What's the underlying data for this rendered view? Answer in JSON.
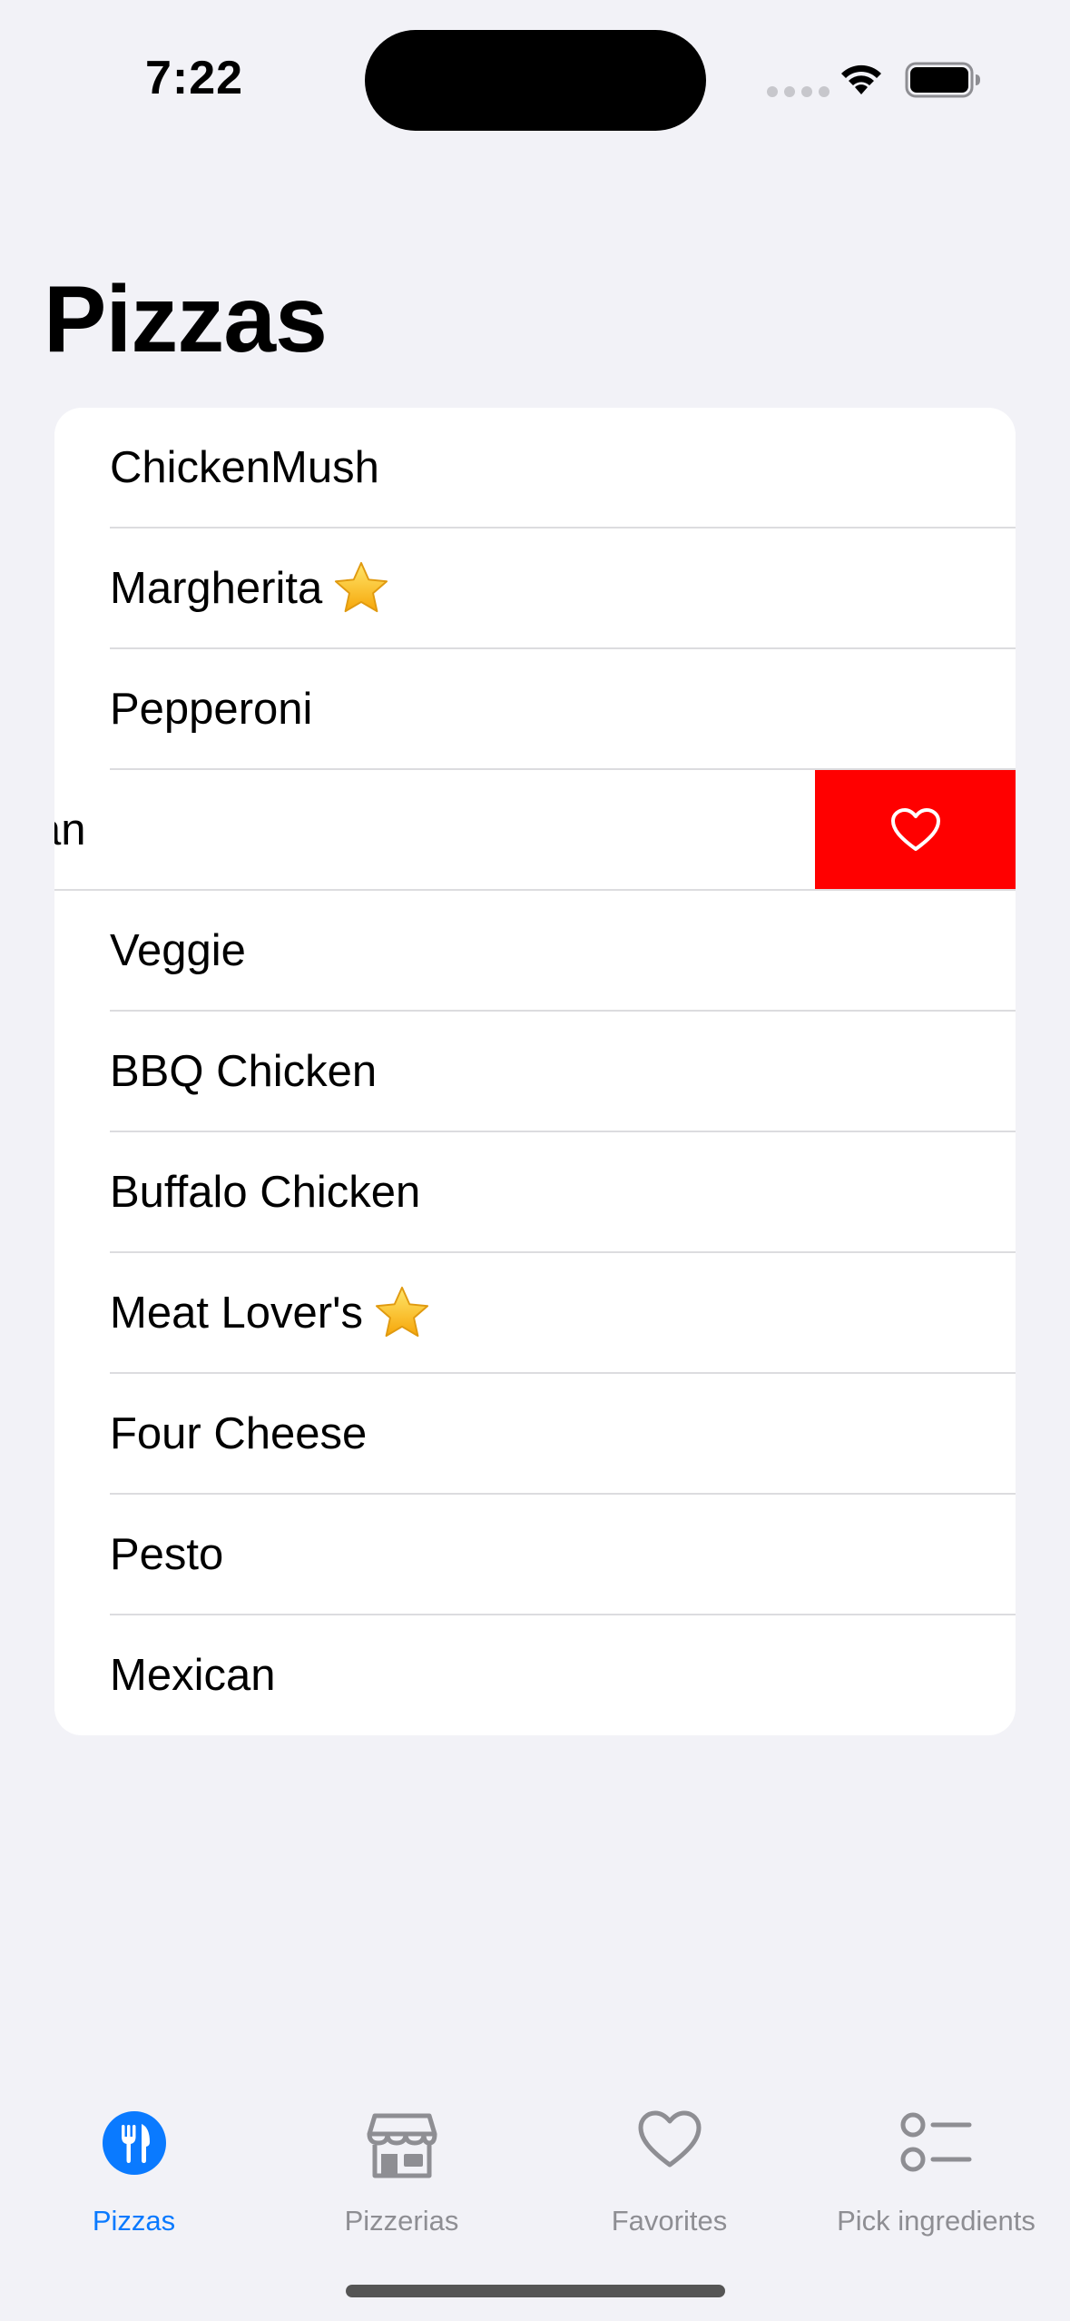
{
  "status_bar": {
    "time": "7:22"
  },
  "page": {
    "title": "Pizzas"
  },
  "list": {
    "items": [
      {
        "label": "ChickenMush",
        "starred": false
      },
      {
        "label": "Margherita",
        "starred": true
      },
      {
        "label": "Pepperoni",
        "starred": false
      },
      {
        "label": "Hawaiian",
        "starred": false,
        "swiped": true,
        "visible_text": "an"
      },
      {
        "label": "Veggie",
        "starred": false
      },
      {
        "label": "BBQ Chicken",
        "starred": false
      },
      {
        "label": "Buffalo Chicken",
        "starred": false
      },
      {
        "label": "Meat Lover's",
        "starred": true
      },
      {
        "label": "Four Cheese",
        "starred": false
      },
      {
        "label": "Pesto",
        "starred": false
      },
      {
        "label": "Mexican",
        "starred": false
      }
    ],
    "swipe_action": {
      "icon": "heart-icon",
      "color": "#ff0000"
    }
  },
  "tab_bar": {
    "tabs": [
      {
        "label": "Pizzas",
        "icon": "fork-knife-icon",
        "active": true
      },
      {
        "label": "Pizzerias",
        "icon": "storefront-icon",
        "active": false
      },
      {
        "label": "Favorites",
        "icon": "heart-icon",
        "active": false
      },
      {
        "label": "Pick ingredients",
        "icon": "list-checklist-icon",
        "active": false
      }
    ],
    "active_color": "#0a7aff",
    "inactive_color": "#8e8e93"
  }
}
